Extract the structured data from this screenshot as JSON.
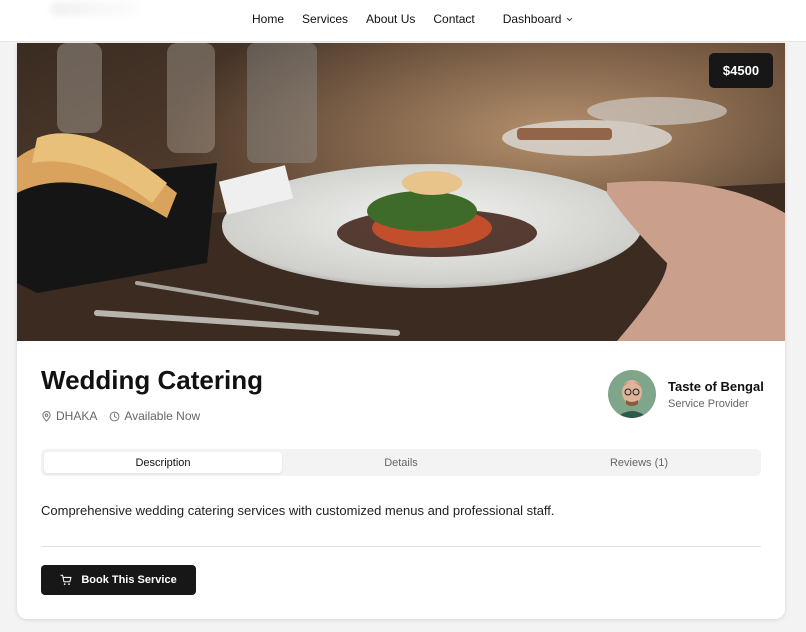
{
  "nav": {
    "links": [
      "Home",
      "Services",
      "About Us",
      "Contact"
    ],
    "dashboard_label": "Dashboard"
  },
  "service": {
    "price": "$4500",
    "title": "Wedding Catering",
    "location": "DHAKA",
    "availability": "Available Now",
    "description": "Comprehensive wedding catering services with customized menus and professional staff.",
    "book_label": "Book This Service"
  },
  "provider": {
    "name": "Taste of Bengal",
    "role": "Service Provider"
  },
  "tabs": [
    "Description",
    "Details",
    "Reviews (1)"
  ],
  "icons": {
    "location": "map-pin-icon",
    "clock": "clock-icon",
    "cart": "shopping-cart-icon",
    "chevron": "chevron-down-icon"
  },
  "colors": {
    "dark": "#171717",
    "background": "#f3f3f4"
  }
}
